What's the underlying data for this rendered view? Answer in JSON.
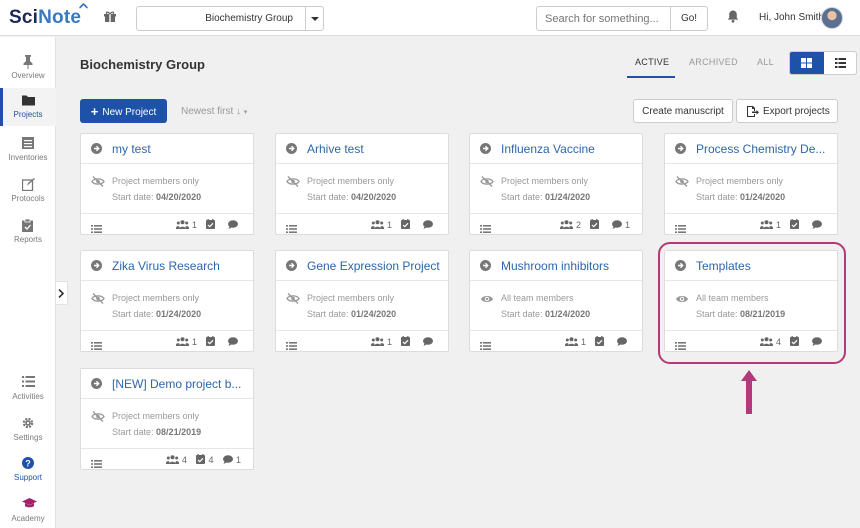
{
  "app": {
    "logo_part1": "Sci",
    "logo_part2": "Note",
    "team": "Biochemistry Group",
    "search_placeholder": "Search for something...",
    "go_label": "Go!",
    "greeting": "Hi, John Smith"
  },
  "sidebar": {
    "top": [
      {
        "label": "Overview",
        "icon": "pin-icon"
      },
      {
        "label": "Projects",
        "icon": "folder-icon",
        "active": true
      },
      {
        "label": "Inventories",
        "icon": "inventory-icon"
      },
      {
        "label": "Protocols",
        "icon": "edit-icon"
      },
      {
        "label": "Reports",
        "icon": "clipboard-icon"
      }
    ],
    "bottom": [
      {
        "label": "Activities",
        "icon": "list-icon"
      },
      {
        "label": "Settings",
        "icon": "gear-icon"
      },
      {
        "label": "Support",
        "icon": "help-icon"
      },
      {
        "label": "Academy",
        "icon": "graduation-cap-icon"
      }
    ]
  },
  "header": {
    "title": "Biochemistry Group",
    "tabs": [
      "ACTIVE",
      "ARCHIVED",
      "ALL"
    ],
    "new_project": "New Project",
    "sort": "Newest first ↓",
    "create_manuscript": "Create manuscript",
    "export_projects": "Export projects"
  },
  "cards": [
    {
      "title": "my test",
      "visibility": "Project members only",
      "date_label": "Start date:",
      "date": "04/20/2020",
      "users": "1",
      "tasks": "",
      "comments": "",
      "public": false
    },
    {
      "title": "Arhive test",
      "visibility": "Project members only",
      "date_label": "Start date:",
      "date": "04/20/2020",
      "users": "1",
      "tasks": "",
      "comments": "",
      "public": false
    },
    {
      "title": "Influenza Vaccine",
      "visibility": "Project members only",
      "date_label": "Start date:",
      "date": "01/24/2020",
      "users": "2",
      "tasks": "",
      "comments": "1",
      "public": false
    },
    {
      "title": "Process Chemistry De...",
      "visibility": "Project members only",
      "date_label": "Start date:",
      "date": "01/24/2020",
      "users": "1",
      "tasks": "",
      "comments": "",
      "public": false
    },
    {
      "title": "Zika Virus Research",
      "visibility": "Project members only",
      "date_label": "Start date:",
      "date": "01/24/2020",
      "users": "1",
      "tasks": "",
      "comments": "",
      "public": false
    },
    {
      "title": "Gene Expression Project",
      "visibility": "Project members only",
      "date_label": "Start date:",
      "date": "01/24/2020",
      "users": "1",
      "tasks": "",
      "comments": "",
      "public": false
    },
    {
      "title": "Mushroom inhibitors",
      "visibility": "All team members",
      "date_label": "Start date:",
      "date": "01/24/2020",
      "users": "1",
      "tasks": "",
      "comments": "",
      "public": true
    },
    {
      "title": "Templates",
      "visibility": "All team members",
      "date_label": "Start date:",
      "date": "08/21/2019",
      "users": "4",
      "tasks": "",
      "comments": "",
      "public": true
    },
    {
      "title": "[NEW] Demo project b...",
      "visibility": "Project members only",
      "date_label": "Start date:",
      "date": "08/21/2019",
      "users": "4",
      "tasks": "4",
      "comments": "1",
      "public": false
    }
  ],
  "colors": {
    "accent": "#1e51a8",
    "link": "#2e65aa",
    "highlight": "#b03a7a"
  }
}
